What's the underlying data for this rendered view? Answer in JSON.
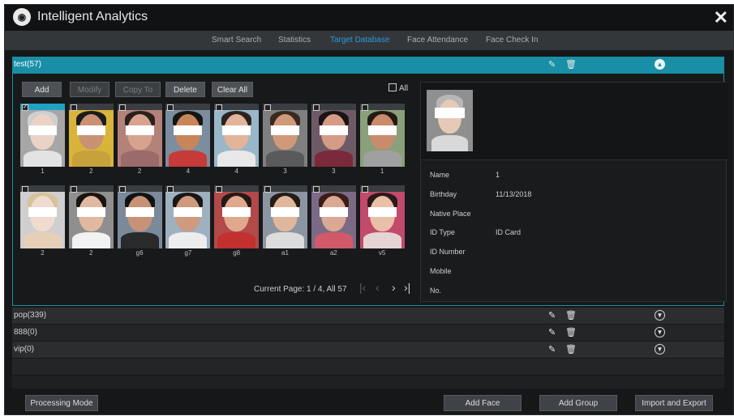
{
  "app": {
    "title": "Intelligent Analytics",
    "close_glyph": "✕",
    "logo_icon": "app-logo-icon"
  },
  "tabs": [
    {
      "label": "Smart Search"
    },
    {
      "label": "Statistics"
    },
    {
      "label": "Target Database"
    },
    {
      "label": "Face Attendance"
    },
    {
      "label": "Face Check In"
    }
  ],
  "active_tab": "Target Database",
  "groups": [
    {
      "name": "test(57)",
      "expanded": true
    },
    {
      "name": "pop(339)",
      "expanded": false
    },
    {
      "name": "888(0)",
      "expanded": false
    },
    {
      "name": "vip(0)",
      "expanded": false
    }
  ],
  "toolbar": {
    "add": "Add",
    "modify": "Modify",
    "copy_to": "Copy To",
    "delete": "Delete",
    "clear_all": "Clear All",
    "all": "All"
  },
  "faces": [
    {
      "label": "1",
      "selected": true
    },
    {
      "label": "2"
    },
    {
      "label": "2"
    },
    {
      "label": "4"
    },
    {
      "label": "4"
    },
    {
      "label": "3"
    },
    {
      "label": "3"
    },
    {
      "label": "1"
    },
    {
      "label": "2"
    },
    {
      "label": "2"
    },
    {
      "label": "g6"
    },
    {
      "label": "g7"
    },
    {
      "label": "g8"
    },
    {
      "label": "a1"
    },
    {
      "label": "a2"
    },
    {
      "label": "v5"
    }
  ],
  "pagination": {
    "text": "Current Page: 1 / 4, All 57",
    "current": 1,
    "total": 4,
    "all": 57
  },
  "detail": {
    "fields": [
      {
        "label": "Name",
        "value": "1"
      },
      {
        "label": "Birthday",
        "value": "11/13/2018"
      },
      {
        "label": "Native Place",
        "value": ""
      },
      {
        "label": "ID Type",
        "value": "ID Card"
      },
      {
        "label": "ID Number",
        "value": ""
      },
      {
        "label": "Mobile",
        "value": ""
      },
      {
        "label": "No.",
        "value": ""
      }
    ]
  },
  "footer": {
    "processing_mode": "Processing Mode",
    "add_face": "Add Face",
    "add_group": "Add Group",
    "import_export": "Import and Export"
  },
  "colors": {
    "accent": "#188fa7",
    "active_tab": "#2a98d8",
    "background": "#161718"
  }
}
